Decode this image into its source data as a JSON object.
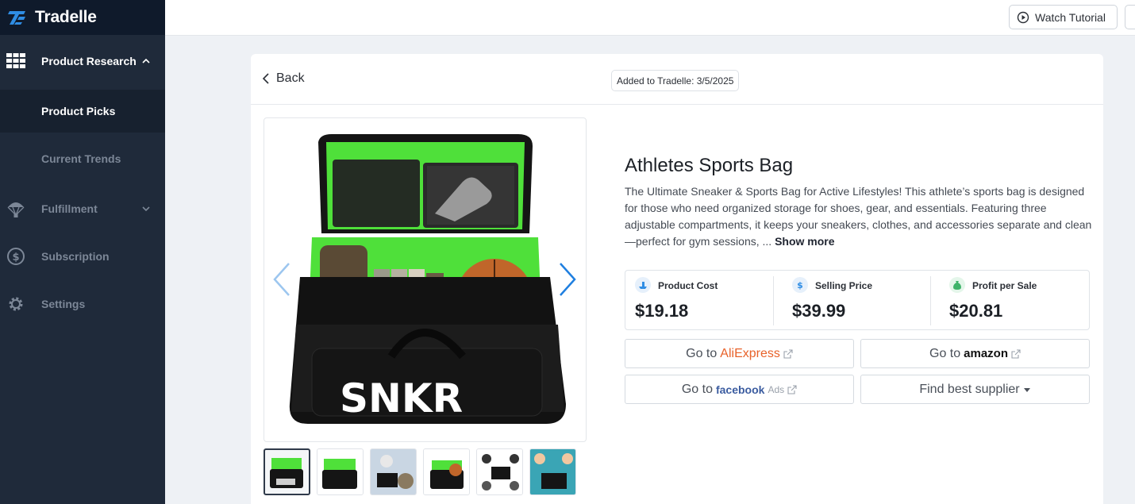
{
  "brand": {
    "name": "Tradelle",
    "accent": "#2f8de4"
  },
  "sidebar": {
    "items": [
      {
        "label": "Product Research",
        "icon": "grid-icon",
        "expanded": true
      },
      {
        "label": "Product Picks",
        "active": true
      },
      {
        "label": "Current Trends"
      },
      {
        "label": "Fulfillment",
        "icon": "parachute-icon"
      },
      {
        "label": "Subscription",
        "icon": "dollar-icon"
      },
      {
        "label": "Settings",
        "icon": "gear-icon"
      }
    ]
  },
  "topbar": {
    "watch_tutorial": "Watch Tutorial"
  },
  "card": {
    "back": "Back",
    "added": "Added to Tradelle: 3/5/2025"
  },
  "product": {
    "title": "Athletes Sports Bag",
    "description": "The Ultimate Sneaker & Sports Bag for Active Lifestyles! This athlete’s sports bag is designed for those who need organized storage for shoes, gear, and essentials. Featuring three adjustable compartments, it keeps your sneakers, clothes, and accessories separate and clean—perfect for gym sessions, ...",
    "show_more": "Show more",
    "image_text": "SNKR",
    "thumb_count": 6,
    "active_thumb": 1
  },
  "stats": [
    {
      "label": "Product Cost",
      "value": "$19.18",
      "icon": "ship-icon"
    },
    {
      "label": "Selling Price",
      "value": "$39.99",
      "icon": "price-tag-icon"
    },
    {
      "label": "Profit per Sale",
      "value": "$20.81",
      "icon": "money-bag-icon"
    }
  ],
  "links": {
    "go_to": "Go to",
    "aliexpress_a": "Ali",
    "aliexpress_b": "Express",
    "amazon": "amazon",
    "facebook": "facebook",
    "facebook_ads": "Ads",
    "find_supplier": "Find best supplier"
  }
}
